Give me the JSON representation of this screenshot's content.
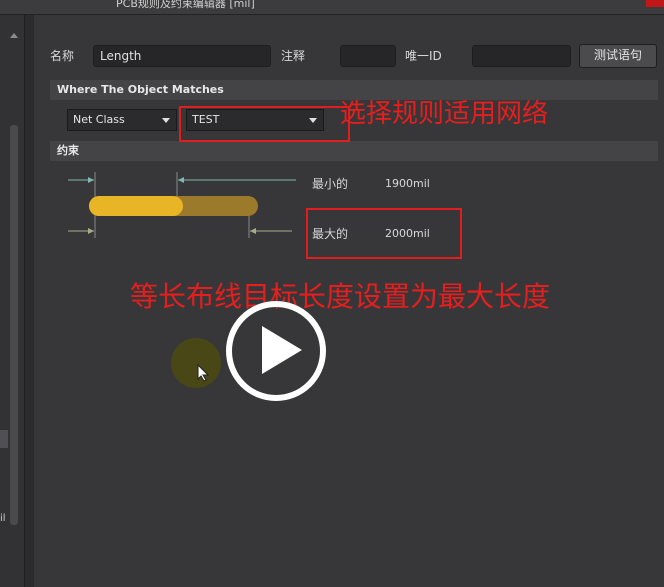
{
  "window": {
    "title": "PCB规则及约束编辑器 [mil]"
  },
  "left_panel": {
    "fragment": "il"
  },
  "form": {
    "name_label": "名称",
    "name_value": "Length",
    "comment_label": "注释",
    "comment_value": "",
    "uid_label": "唯一ID",
    "uid_value": "",
    "test_button": "测试语句"
  },
  "where": {
    "heading": "Where The Object Matches",
    "type_value": "Net Class",
    "object_value": "TEST"
  },
  "constraints": {
    "heading": "约束",
    "min_label": "最小的",
    "min_value": "1900mil",
    "max_label": "最大的",
    "max_value": "2000mil",
    "bar_fill_fraction": 0.95
  },
  "annotations": {
    "network_note": "选择规则适用网络",
    "length_note": "等长布线目标长度设置为最大长度"
  },
  "overlay": {
    "icon": "play-icon"
  },
  "colors": {
    "bar_gold": "#e8b526",
    "bar_bg": "#9c7a2c",
    "annotation_red": "#e61e1e",
    "tick_cyan": "#7fb8b0",
    "tick_green": "#a7ad8a"
  }
}
